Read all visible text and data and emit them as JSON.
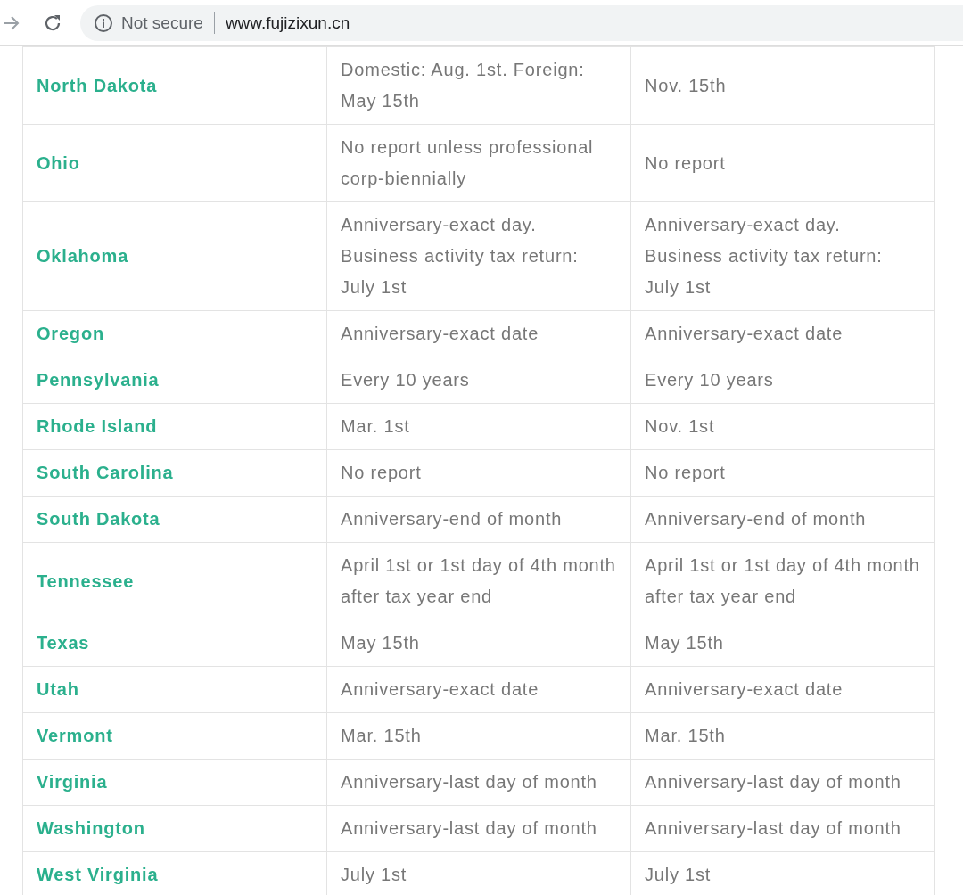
{
  "browser": {
    "security_label": "Not secure",
    "url": "www.fujizixun.cn"
  },
  "table": {
    "rows": [
      {
        "state": "North Dakota",
        "column_2": "Domestic: Aug. 1st. Foreign: May 15th",
        "column_3": "Nov. 15th"
      },
      {
        "state": "Ohio",
        "column_2": "No report unless professional corp-biennially",
        "column_3": "No report"
      },
      {
        "state": "Oklahoma",
        "column_2": "Anniversary-exact day. Business activity tax return: July 1st",
        "column_3": "Anniversary-exact day. Business activity tax return: July 1st"
      },
      {
        "state": "Oregon",
        "column_2": "Anniversary-exact date",
        "column_3": "Anniversary-exact date"
      },
      {
        "state": "Pennsylvania",
        "column_2": "Every 10 years",
        "column_3": "Every 10 years"
      },
      {
        "state": "Rhode Island",
        "column_2": "Mar. 1st",
        "column_3": "Nov. 1st"
      },
      {
        "state": "South Carolina",
        "column_2": "No report",
        "column_3": "No report"
      },
      {
        "state": "South Dakota",
        "column_2": "Anniversary-end of month",
        "column_3": "Anniversary-end of month"
      },
      {
        "state": "Tennessee",
        "column_2": "April 1st or 1st day of 4th month after tax year end",
        "column_3": "April 1st or 1st day of 4th month after tax year end"
      },
      {
        "state": "Texas",
        "column_2": "May 15th",
        "column_3": "May 15th"
      },
      {
        "state": "Utah",
        "column_2": "Anniversary-exact date",
        "column_3": "Anniversary-exact date"
      },
      {
        "state": "Vermont",
        "column_2": "Mar. 15th",
        "column_3": "Mar. 15th"
      },
      {
        "state": "Virginia",
        "column_2": "Anniversary-last day of month",
        "column_3": "Anniversary-last day of month"
      },
      {
        "state": "Washington",
        "column_2": "Anniversary-last day of month",
        "column_3": "Anniversary-last day of month"
      },
      {
        "state": "West Virginia",
        "column_2": "July 1st",
        "column_3": "July 1st"
      }
    ]
  }
}
